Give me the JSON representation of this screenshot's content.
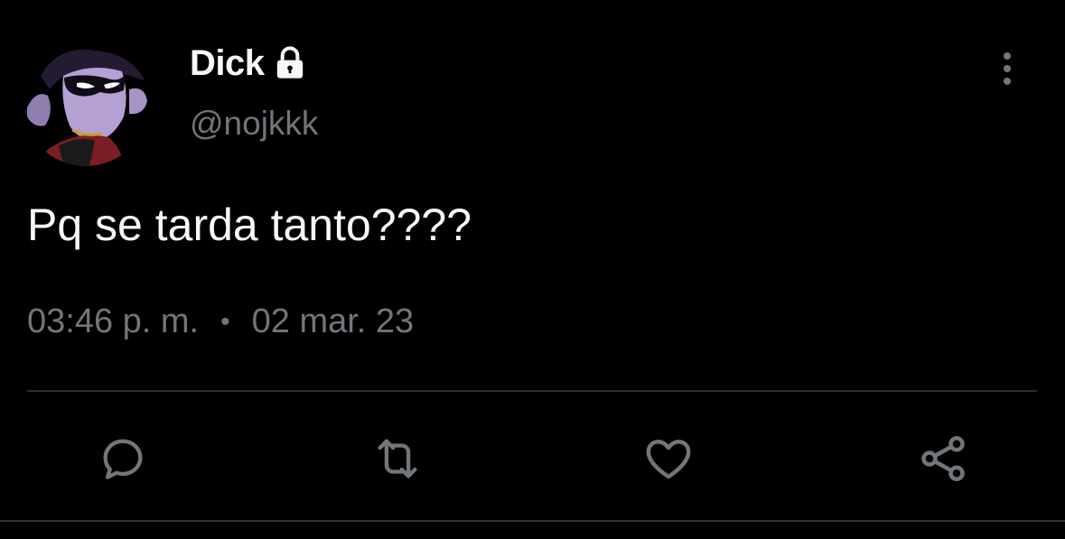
{
  "user": {
    "display_name": "Dick",
    "handle": "@nojkkk",
    "protected_icon": "lock-icon",
    "avatar": "avatar-image"
  },
  "tweet": {
    "text": "Pq se tarda tanto????",
    "time": "03:46 p. m.",
    "separator": "•",
    "date": "02 mar. 23"
  },
  "actions": [
    {
      "name": "reply",
      "icon": "reply-icon"
    },
    {
      "name": "retweet",
      "icon": "retweet-icon"
    },
    {
      "name": "like",
      "icon": "heart-icon"
    },
    {
      "name": "share",
      "icon": "share-icon"
    }
  ],
  "menu_icon": "more-vertical-icon",
  "colors": {
    "background": "#000000",
    "primary_text": "#f7f9f9",
    "secondary_text": "#71767b",
    "divider": "#2f3336",
    "icon": "#71767b"
  }
}
